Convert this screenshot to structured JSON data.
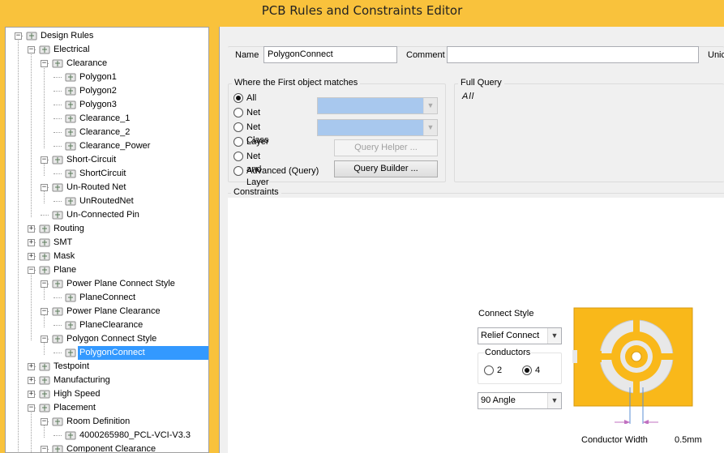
{
  "window": {
    "title": "PCB Rules and Constraints Editor"
  },
  "tree": {
    "rows": [
      {
        "label": "Design Rules",
        "expander": "−"
      },
      {
        "label": "Electrical",
        "expander": "−"
      },
      {
        "label": "Clearance",
        "expander": "−"
      },
      {
        "label": "Polygon1"
      },
      {
        "label": "Polygon2"
      },
      {
        "label": "Polygon3"
      },
      {
        "label": "Clearance_1"
      },
      {
        "label": "Clearance_2"
      },
      {
        "label": "Clearance_Power"
      },
      {
        "label": "Short-Circuit",
        "expander": "−"
      },
      {
        "label": "ShortCircuit"
      },
      {
        "label": "Un-Routed Net",
        "expander": "−"
      },
      {
        "label": "UnRoutedNet"
      },
      {
        "label": "Un-Connected Pin"
      },
      {
        "label": "Routing",
        "expander": "+"
      },
      {
        "label": "SMT",
        "expander": "+"
      },
      {
        "label": "Mask",
        "expander": "+"
      },
      {
        "label": "Plane",
        "expander": "−"
      },
      {
        "label": "Power Plane Connect Style",
        "expander": "−"
      },
      {
        "label": "PlaneConnect"
      },
      {
        "label": "Power Plane Clearance",
        "expander": "−"
      },
      {
        "label": "PlaneClearance"
      },
      {
        "label": "Polygon Connect Style",
        "expander": "−"
      },
      {
        "label": "PolygonConnect",
        "selected": true
      },
      {
        "label": "Testpoint",
        "expander": "+"
      },
      {
        "label": "Manufacturing",
        "expander": "+"
      },
      {
        "label": "High Speed",
        "expander": "+"
      },
      {
        "label": "Placement",
        "expander": "−"
      },
      {
        "label": "Room Definition",
        "expander": "−"
      },
      {
        "label": "4000265980_PCL-VCI-V3.3"
      },
      {
        "label": "Component Clearance",
        "expander": "−"
      }
    ]
  },
  "rule": {
    "name_label": "Name",
    "name_value": "PolygonConnect",
    "comment_label": "Comment",
    "comment_value": "",
    "unique_label": "Unic"
  },
  "first_object": {
    "title": "Where the First object matches",
    "options": [
      "All",
      "Net",
      "Net Class",
      "Layer",
      "Net and Layer",
      "Advanced (Query)"
    ],
    "selected": "All",
    "query_helper": "Query Helper ...",
    "query_builder": "Query Builder ..."
  },
  "full_query": {
    "title": "Full Query",
    "text": "All"
  },
  "constraints": {
    "title": "Constraints",
    "connect_style_label": "Connect Style",
    "connect_style_value": "Relief Connect",
    "conductors_title": "Conductors",
    "conductor_options": [
      "2",
      "4"
    ],
    "conductor_selected": "4",
    "angle_value": "90 Angle",
    "conductor_width_label": "Conductor Width",
    "conductor_width_value": "0.5mm"
  },
  "colors": {
    "accent": "#f9c23c",
    "selection": "#3399ff",
    "pad": "#f9b81a",
    "pad_shadow": "#e0a01a"
  }
}
